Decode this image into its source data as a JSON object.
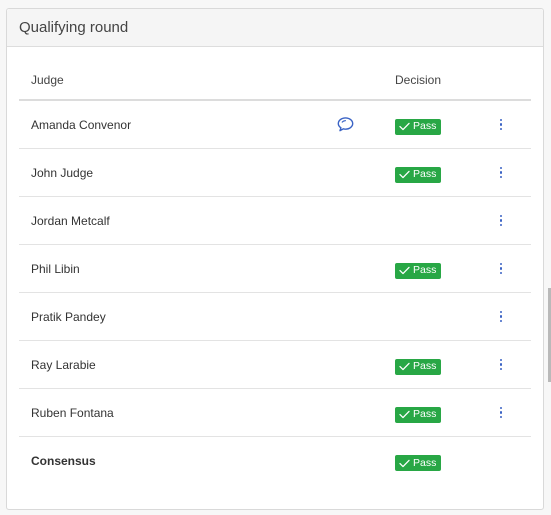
{
  "panel": {
    "title": "Qualifying round"
  },
  "table": {
    "headers": {
      "judge": "Judge",
      "decision": "Decision"
    },
    "rows": [
      {
        "name": "Amanda Convenor",
        "decision": "Pass",
        "has_comment": true,
        "has_menu": true
      },
      {
        "name": "John Judge",
        "decision": "Pass",
        "has_comment": false,
        "has_menu": true
      },
      {
        "name": "Jordan Metcalf",
        "decision": "",
        "has_comment": false,
        "has_menu": true
      },
      {
        "name": "Phil Libin",
        "decision": "Pass",
        "has_comment": false,
        "has_menu": true
      },
      {
        "name": "Pratik Pandey",
        "decision": "",
        "has_comment": false,
        "has_menu": true
      },
      {
        "name": "Ray Larabie",
        "decision": "Pass",
        "has_comment": false,
        "has_menu": true
      },
      {
        "name": "Ruben Fontana",
        "decision": "Pass",
        "has_comment": false,
        "has_menu": true
      },
      {
        "name": "Consensus",
        "decision": "Pass",
        "has_comment": false,
        "has_menu": false
      }
    ]
  },
  "icons": {
    "comment": "comment-bubble-icon",
    "check": "check-icon",
    "menu": "vertical-ellipsis-icon"
  },
  "colors": {
    "pass": "#28a745",
    "accent": "#3a63c5"
  }
}
